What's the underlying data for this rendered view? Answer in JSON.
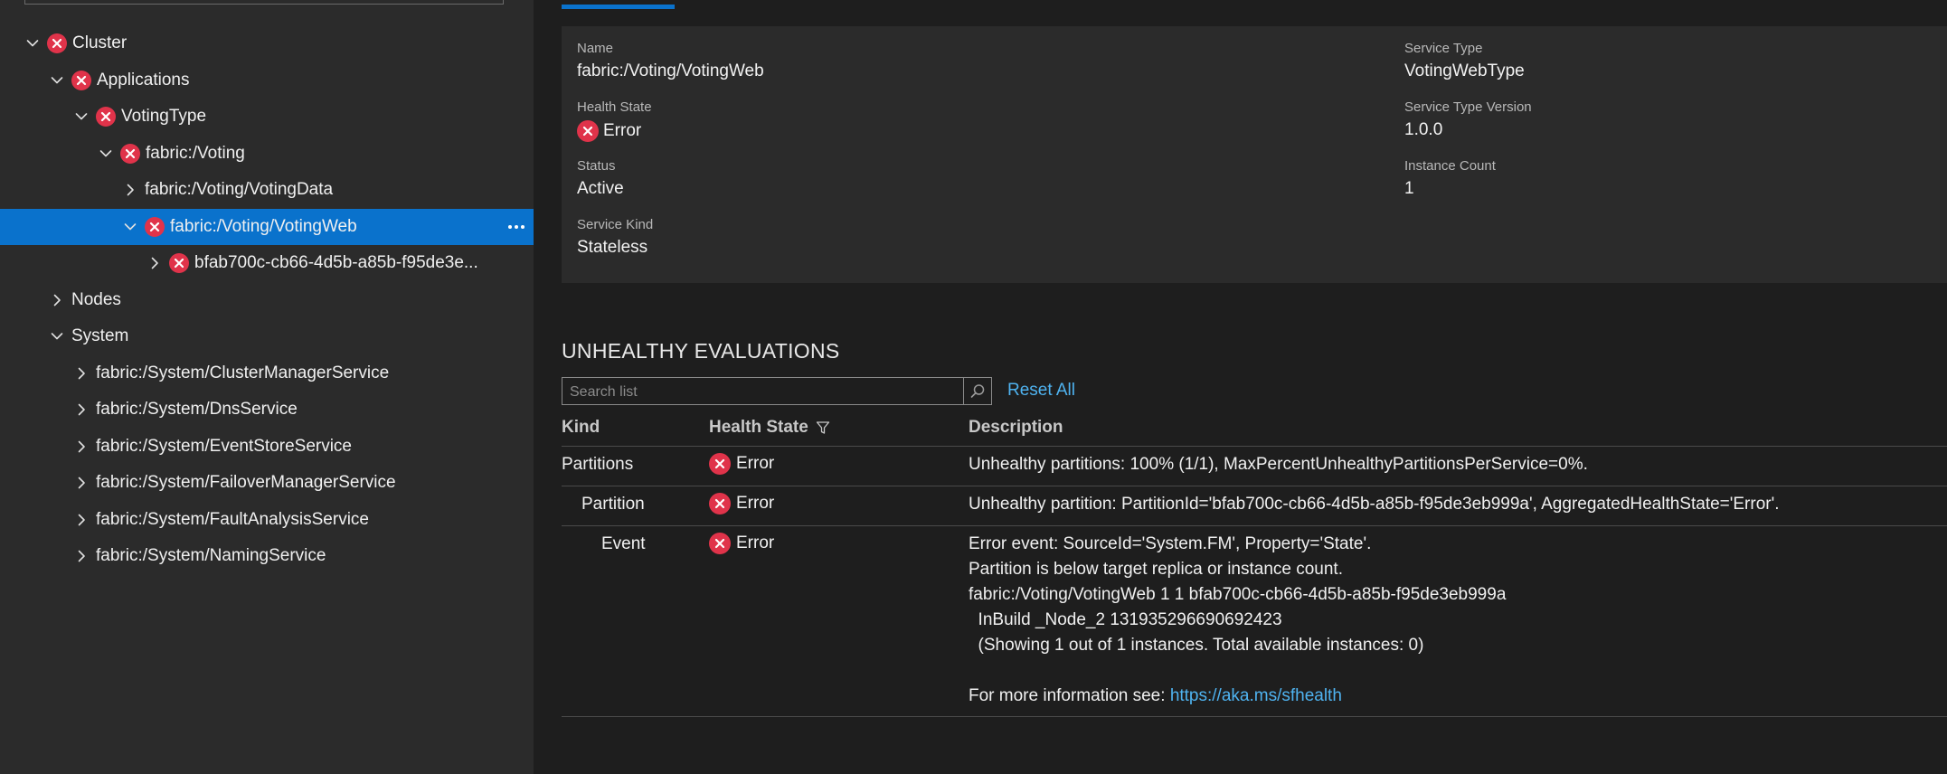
{
  "sidebar": {
    "tree": [
      {
        "label": "Cluster",
        "expanded": true,
        "error": true
      },
      {
        "label": "Applications",
        "expanded": true,
        "error": true
      },
      {
        "label": "VotingType",
        "expanded": true,
        "error": true
      },
      {
        "label": "fabric:/Voting",
        "expanded": true,
        "error": true
      },
      {
        "label": "fabric:/Voting/VotingData",
        "expanded": false,
        "error": false
      },
      {
        "label": "fabric:/Voting/VotingWeb",
        "expanded": true,
        "error": true,
        "selected": true
      },
      {
        "label": "bfab700c-cb66-4d5b-a85b-f95de3e...",
        "expanded": false,
        "error": true
      },
      {
        "label": "Nodes",
        "expanded": false,
        "error": false
      },
      {
        "label": "System",
        "expanded": true,
        "error": false
      },
      {
        "label": "fabric:/System/ClusterManagerService",
        "expanded": false,
        "error": false
      },
      {
        "label": "fabric:/System/DnsService",
        "expanded": false,
        "error": false
      },
      {
        "label": "fabric:/System/EventStoreService",
        "expanded": false,
        "error": false
      },
      {
        "label": "fabric:/System/FailoverManagerService",
        "expanded": false,
        "error": false
      },
      {
        "label": "fabric:/System/FaultAnalysisService",
        "expanded": false,
        "error": false
      },
      {
        "label": "fabric:/System/NamingService",
        "expanded": false,
        "error": false
      }
    ]
  },
  "essentials": {
    "name_label": "Name",
    "name_value": "fabric:/Voting/VotingWeb",
    "health_label": "Health State",
    "health_value": "Error",
    "status_label": "Status",
    "status_value": "Active",
    "kind_label": "Service Kind",
    "kind_value": "Stateless",
    "type_label": "Service Type",
    "type_value": "VotingWebType",
    "type_version_label": "Service Type Version",
    "type_version_value": "1.0.0",
    "instance_label": "Instance Count",
    "instance_value": "1"
  },
  "unhealthy": {
    "title": "UNHEALTHY EVALUATIONS",
    "search_placeholder": "Search list",
    "reset_label": "Reset All",
    "columns": {
      "kind": "Kind",
      "health": "Health State",
      "description": "Description"
    },
    "rows": [
      {
        "kind": "Partitions",
        "state": "Error",
        "desc": [
          "Unhealthy partitions: 100% (1/1), MaxPercentUnhealthyPartitionsPerService=0%."
        ]
      },
      {
        "kind": "Partition",
        "state": "Error",
        "desc": [
          "Unhealthy partition: PartitionId='bfab700c-cb66-4d5b-a85b-f95de3eb999a', AggregatedHealthState='Error'."
        ]
      },
      {
        "kind": "Event",
        "state": "Error",
        "desc": [
          "Error event: SourceId='System.FM', Property='State'.",
          "Partition is below target replica or instance count.",
          "fabric:/Voting/VotingWeb 1 1 bfab700c-cb66-4d5b-a85b-f95de3eb999a",
          "  InBuild _Node_2 131935296690692423",
          "  (Showing 1 out of 1 instances. Total available instances: 0)",
          ""
        ],
        "more_info_text": "For more information see: ",
        "more_info_link": "https://aka.ms/sfhealth"
      }
    ]
  }
}
